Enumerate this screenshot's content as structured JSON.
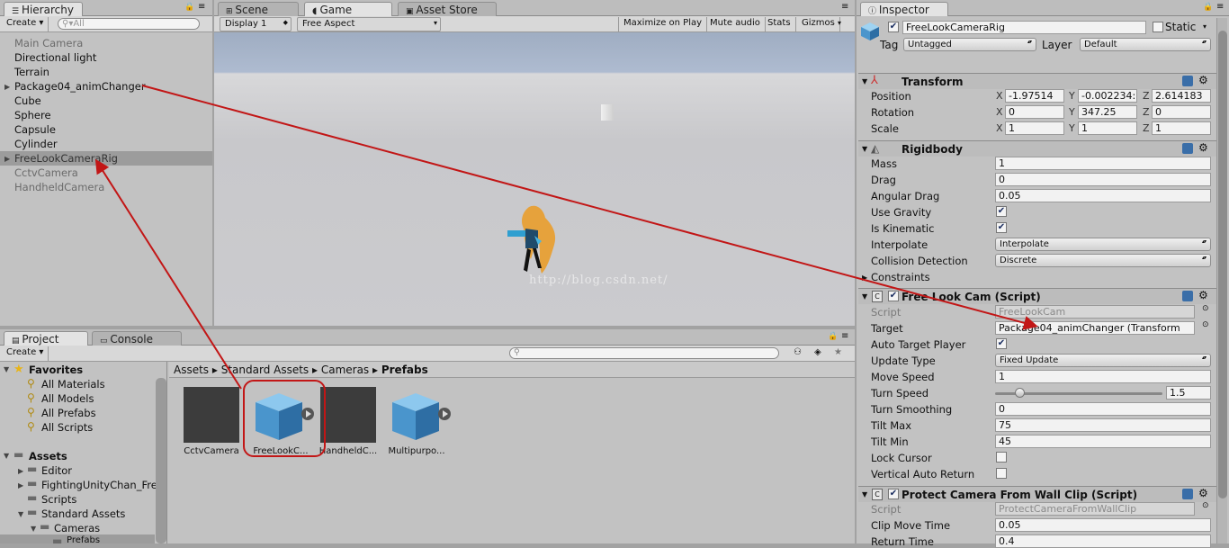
{
  "hierarchy": {
    "tab": "Hierarchy",
    "create": "Create",
    "search_placeholder": "All",
    "items": [
      "Main Camera",
      "Directional light",
      "Terrain",
      "Package04_animChanger",
      "Cube",
      "Sphere",
      "Capsule",
      "Cylinder",
      "FreeLookCameraRig",
      "CctvCamera",
      "HandheldCamera"
    ]
  },
  "center_tabs": {
    "scene": "Scene",
    "game": "Game",
    "asset_store": "Asset Store"
  },
  "game_toolbar": {
    "display": "Display 1",
    "aspect": "Free Aspect",
    "maximize": "Maximize on Play",
    "mute": "Mute audio",
    "stats": "Stats",
    "gizmos": "Gizmos"
  },
  "watermark": "http://blog.csdn.net/",
  "project": {
    "tab": "Project",
    "console_tab": "Console",
    "create": "Create",
    "favorites_label": "Favorites",
    "favorites": [
      "All Materials",
      "All Models",
      "All Prefabs",
      "All Scripts"
    ],
    "assets_label": "Assets",
    "folders": [
      "Editor",
      "FightingUnityChan_Fre",
      "Scripts",
      "Standard Assets",
      "Cameras",
      "Prefabs"
    ],
    "breadcrumb": [
      "Assets",
      "Standard Assets",
      "Cameras",
      "Prefabs"
    ],
    "assets": [
      "CctvCamera",
      "FreeLookC...",
      "HandheldC...",
      "Multipurpo..."
    ]
  },
  "inspector": {
    "tab": "Inspector",
    "object_name": "FreeLookCameraRig",
    "static_label": "Static",
    "tag_label": "Tag",
    "tag": "Untagged",
    "layer_label": "Layer",
    "layer": "Default",
    "transform": {
      "title": "Transform",
      "position_label": "Position",
      "rotation_label": "Rotation",
      "scale_label": "Scale",
      "position": {
        "x": "-1.97514",
        "y": "-0.002234:",
        "z": "2.614183"
      },
      "rotation": {
        "x": "0",
        "y": "347.25",
        "z": "0"
      },
      "scale": {
        "x": "1",
        "y": "1",
        "z": "1"
      }
    },
    "rigidbody": {
      "title": "Rigidbody",
      "mass_label": "Mass",
      "mass": "1",
      "drag_label": "Drag",
      "drag": "0",
      "angular_drag_label": "Angular Drag",
      "angular_drag": "0.05",
      "use_gravity_label": "Use Gravity",
      "is_kinematic_label": "Is Kinematic",
      "interpolate_label": "Interpolate",
      "interpolate": "Interpolate",
      "collision_label": "Collision Detection",
      "collision": "Discrete",
      "constraints_label": "Constraints"
    },
    "freelook": {
      "title": "Free Look Cam (Script)",
      "script_label": "Script",
      "script": "FreeLookCam",
      "target_label": "Target",
      "target": "Package04_animChanger (Transform",
      "auto_target_label": "Auto Target Player",
      "update_type_label": "Update Type",
      "update_type": "Fixed Update",
      "move_speed_label": "Move Speed",
      "move_speed": "1",
      "turn_speed_label": "Turn Speed",
      "turn_speed": "1.5",
      "turn_speed_fraction": 0.15,
      "turn_smoothing_label": "Turn Smoothing",
      "turn_smoothing": "0",
      "tilt_max_label": "Tilt Max",
      "tilt_max": "75",
      "tilt_min_label": "Tilt Min",
      "tilt_min": "45",
      "lock_cursor_label": "Lock Cursor",
      "vertical_return_label": "Vertical Auto Return"
    },
    "protect": {
      "title": "Protect Camera From Wall Clip (Script)",
      "script_label": "Script",
      "script": "ProtectCameraFromWallClip",
      "clip_move_label": "Clip Move Time",
      "clip_move": "0.05",
      "return_time_label": "Return Time",
      "return_time": "0.4"
    }
  }
}
